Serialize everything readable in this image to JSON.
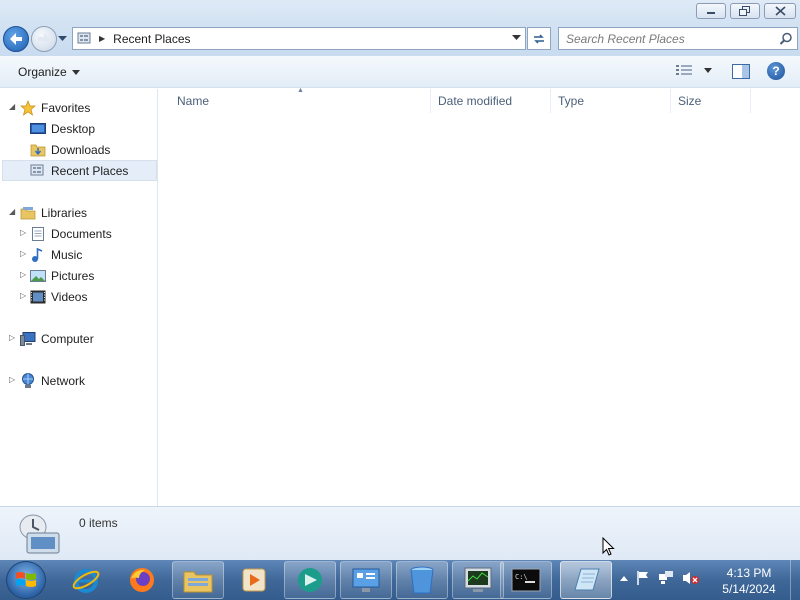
{
  "window": {
    "title_bar_buttons": [
      "minimize",
      "maximize",
      "close"
    ]
  },
  "address": {
    "path_segment": "Recent Places",
    "search_placeholder": "Search Recent Places"
  },
  "toolbar": {
    "organize_label": "Organize"
  },
  "nav": {
    "favorites_label": "Favorites",
    "favorites_items": [
      {
        "label": "Desktop",
        "icon": "desktop-icon"
      },
      {
        "label": "Downloads",
        "icon": "downloads-folder-icon"
      },
      {
        "label": "Recent Places",
        "icon": "recent-places-icon",
        "selected": true
      }
    ],
    "libraries_label": "Libraries",
    "libraries_items": [
      {
        "label": "Documents",
        "icon": "documents-icon"
      },
      {
        "label": "Music",
        "icon": "music-icon"
      },
      {
        "label": "Pictures",
        "icon": "pictures-icon"
      },
      {
        "label": "Videos",
        "icon": "videos-icon"
      }
    ],
    "computer_label": "Computer",
    "network_label": "Network"
  },
  "columns": [
    "Name",
    "Date modified",
    "Type",
    "Size"
  ],
  "details": {
    "item_count": "0 items"
  },
  "taskbar": {
    "pinned": [
      "internet-explorer-icon",
      "firefox-icon",
      "windows-explorer-icon",
      "media-player-icon",
      "app-icon",
      "control-panel-icon",
      "recycle-bin-icon",
      "task-manager-icon",
      "command-prompt-icon",
      "notepad-icon"
    ],
    "active_app": "notepad-icon",
    "tray_icons": [
      "show-hidden-icons-arrow",
      "action-center-flag-icon",
      "network-icon",
      "volume-muted-icon"
    ],
    "clock_time": "4:13 PM",
    "clock_date": "5/14/2024"
  },
  "colors": {
    "title_bar": "#d2e2f3",
    "taskbar": "#3f6798",
    "selection": "#e5eef8",
    "column_header_text": "#4c607a"
  }
}
